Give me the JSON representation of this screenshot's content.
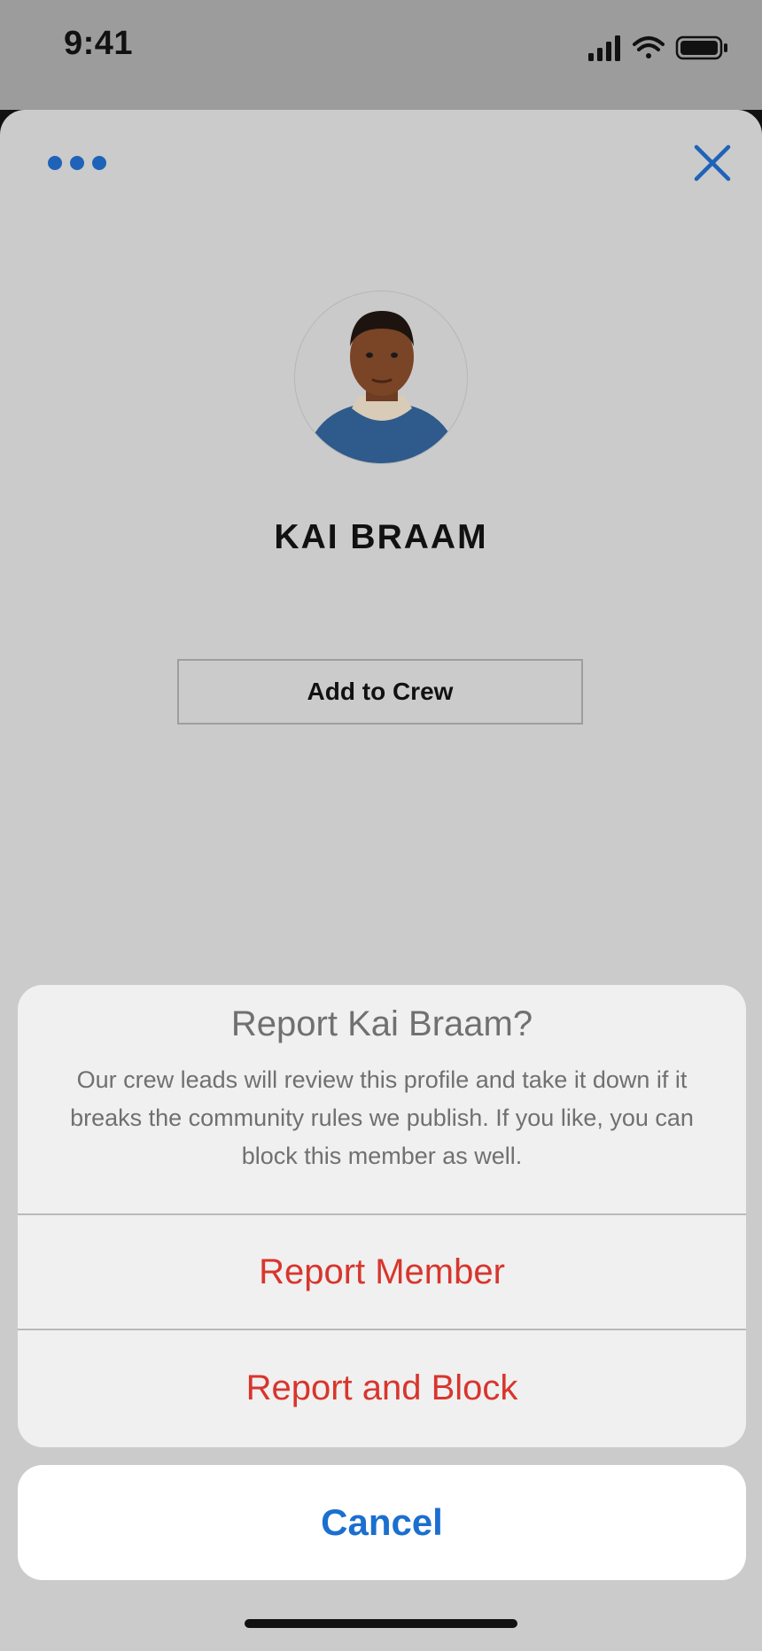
{
  "status_bar": {
    "time": "9:41",
    "icons": [
      "signal-icon",
      "wifi-icon",
      "battery-icon"
    ]
  },
  "sheet": {
    "more_icon": "more-horizontal-icon",
    "close_icon": "close-icon",
    "profile": {
      "avatar": "avatar-photo",
      "name": "KAI BRAAM",
      "add_button_label": "Add to Crew"
    }
  },
  "action_sheet": {
    "title": "Report Kai Braam?",
    "message": "Our crew leads will review this profile and take it down if it breaks the community rules we publish. If you like, you can block this member as well.",
    "actions": [
      {
        "label": "Report Member"
      },
      {
        "label": "Report and Block"
      }
    ],
    "cancel_label": "Cancel"
  },
  "colors": {
    "accent": "#1b6fd0",
    "destructive": "#d8352d",
    "sheet_background": "#cbcbcb"
  }
}
